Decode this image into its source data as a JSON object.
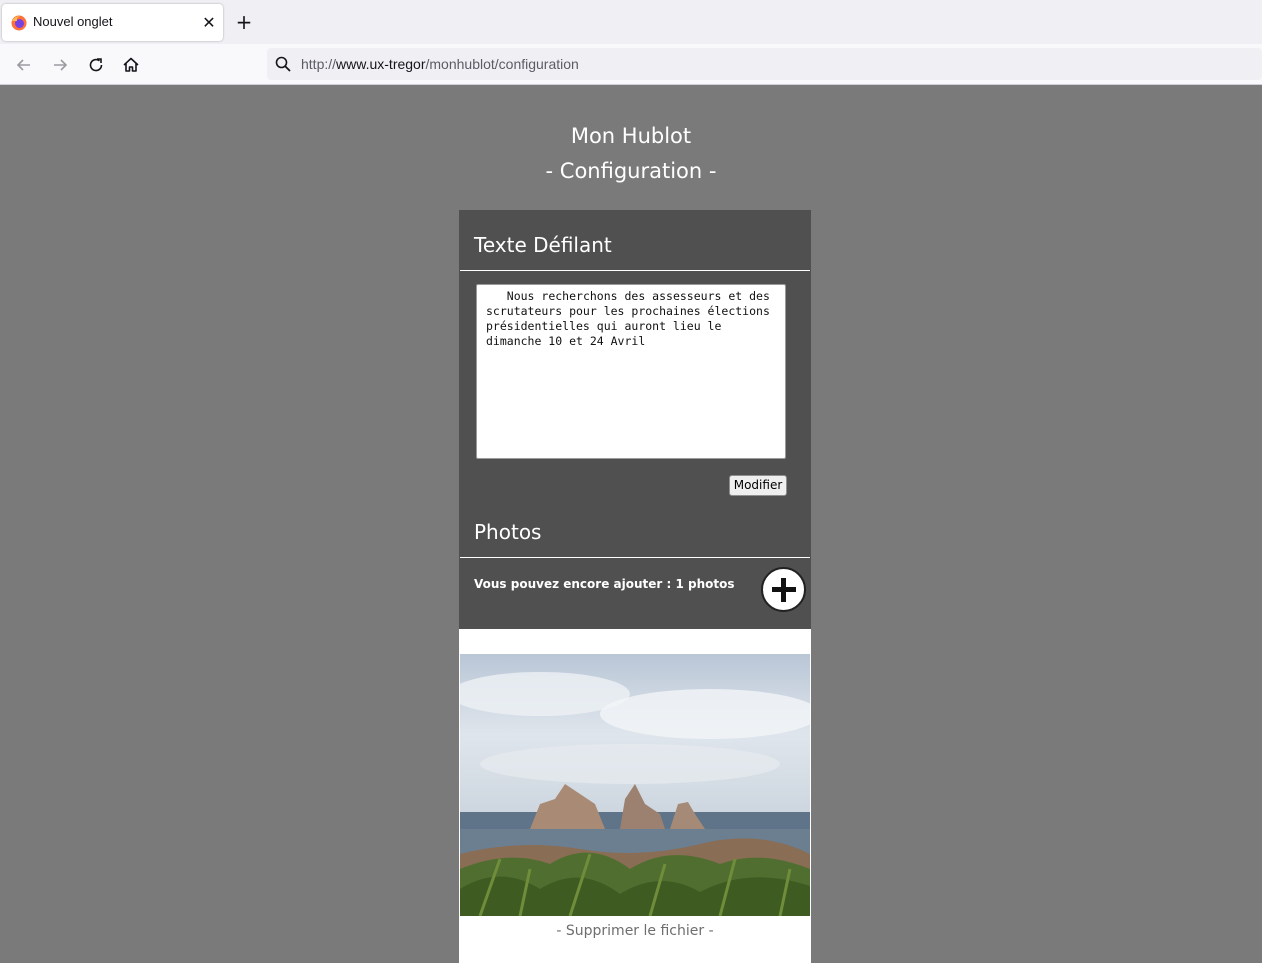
{
  "browser": {
    "tab_title": "Nouvel onglet",
    "tab_close_glyph": "✕",
    "new_tab_glyph": "+",
    "url_scheme": "http://",
    "url_host": "www.ux-tregor",
    "url_path": "/monhublot/configuration",
    "icons": [
      "firefox-icon",
      "back-arrow-icon",
      "forward-arrow-icon",
      "reload-icon",
      "home-icon",
      "search-icon"
    ]
  },
  "page": {
    "title": "Mon Hublot",
    "subtitle": "- Configuration -"
  },
  "scrolling_text": {
    "heading": "Texte Défilant",
    "value": "   Nous recherchons des assesseurs et des scrutateurs pour les prochaines élections présidentielles qui auront lieu le dimanche 10 et 24 Avril",
    "button_label": "Modifier"
  },
  "photos": {
    "heading": "Photos",
    "remaining_text": "Vous pouvez encore ajouter : 1 photos",
    "add_icon": "plus-icon",
    "delete_label": "- Supprimer le fichier -"
  },
  "colors": {
    "page_bg": "#7a7a7a",
    "panel_bg": "#505050",
    "text_on_dark": "#ffffff",
    "delete_link": "#6e6e6e"
  }
}
